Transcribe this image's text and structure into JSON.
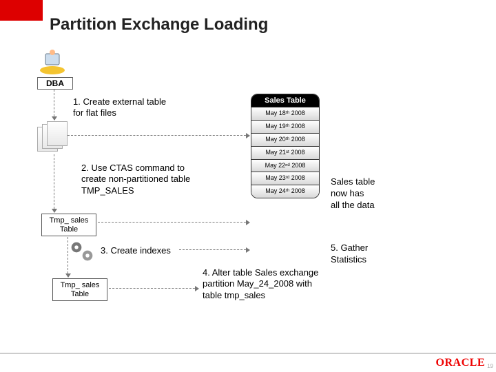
{
  "title": "Partition Exchange Loading",
  "dba_label": "DBA",
  "steps": {
    "s1": "1. Create external table\nfor flat files",
    "s2": "2. Use CTAS command to create non-partitioned table TMP_SALES",
    "s3": "3. Create indexes",
    "s4": "4. Alter table Sales exchange partition May_24_2008 with table tmp_sales"
  },
  "notes": {
    "n1": "Sales table\nnow has\nall the data",
    "n2": "5. Gather\nStatistics"
  },
  "tmp_label": "Tmp_ sales\nTable",
  "sales": {
    "header": "Sales Table",
    "partitions": [
      "May 18ᵗʰ 2008",
      "May 19ᵗʰ 2008",
      "May 20ᵗʰ 2008",
      "May 21ˢᵗ 2008",
      "May 22ⁿᵈ 2008",
      "May 23ʳᵈ 2008",
      "May 24ᵗʰ 2008"
    ]
  },
  "brand": "ORACLE",
  "page": "19"
}
